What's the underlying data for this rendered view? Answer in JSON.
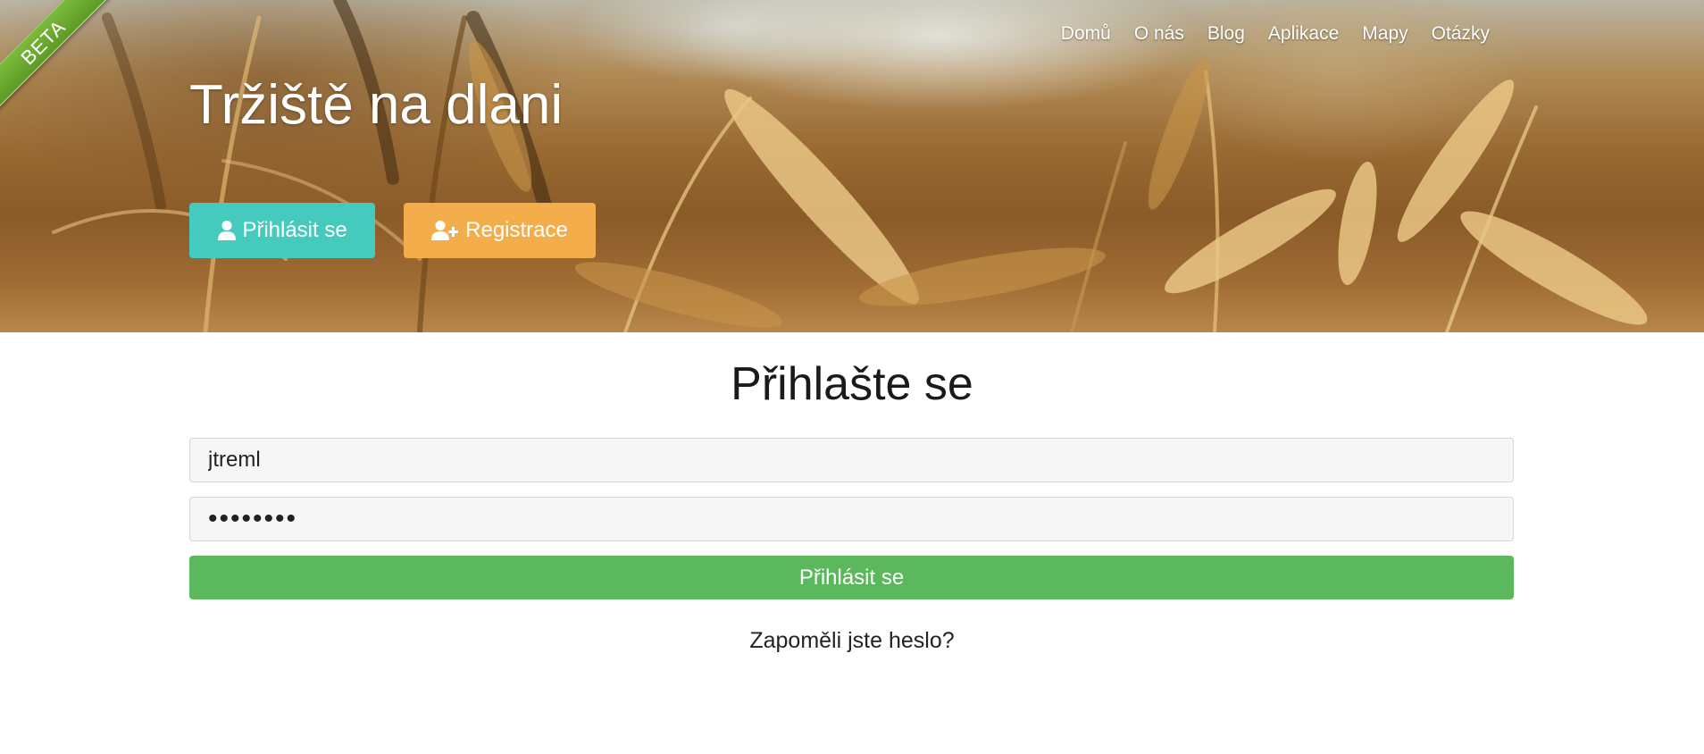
{
  "hero": {
    "badge": "BETA",
    "site_title": "Tržiště na dlani",
    "login_button": "Přihlásit se",
    "register_button": "Registrace"
  },
  "nav": {
    "items": [
      {
        "label": "Domů"
      },
      {
        "label": "O nás"
      },
      {
        "label": "Blog"
      },
      {
        "label": "Aplikace"
      },
      {
        "label": "Mapy"
      },
      {
        "label": "Otázky"
      }
    ]
  },
  "login_form": {
    "title": "Přihlašte se",
    "username_value": "jtreml",
    "password_value": "••••••••",
    "submit_label": "Přihlásit se",
    "forgot_link": "Zapoměli jste heslo?"
  },
  "colors": {
    "login_hero_button": "#45cbbd",
    "register_hero_button": "#f3ad4b",
    "submit_button": "#5cb85c",
    "beta_ribbon": "#6aab2e"
  },
  "icons": {
    "login_hero_button": "user-icon",
    "register_hero_button": "user-plus-icon"
  }
}
